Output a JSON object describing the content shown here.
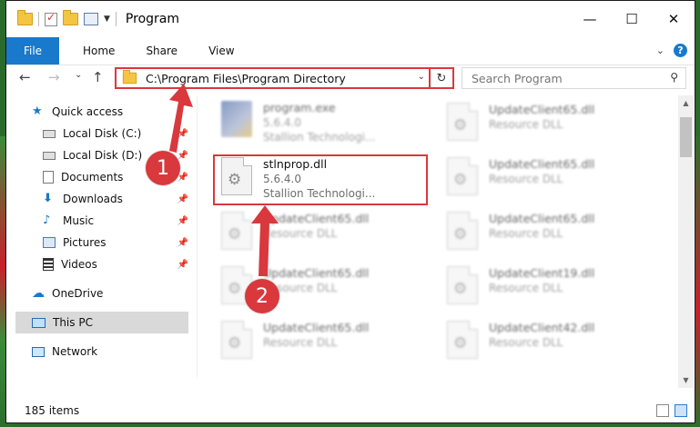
{
  "window": {
    "title": "Program",
    "minimize": "—",
    "maximize": "☐",
    "close": "✕"
  },
  "ribbon": {
    "tabs": [
      "File",
      "Home",
      "Share",
      "View"
    ],
    "help": "?"
  },
  "nav": {
    "back": "←",
    "forward": "→",
    "recent": "⌄",
    "up": "↑",
    "address": "C:\\Program Files\\Program Directory",
    "refresh": "↻",
    "search_placeholder": "Search Program"
  },
  "sidebar": {
    "items": [
      {
        "label": "Quick access",
        "pinned": false
      },
      {
        "label": "Local Disk (C:)",
        "pinned": true
      },
      {
        "label": "Local Disk (D:)",
        "pinned": true
      },
      {
        "label": "Documents",
        "pinned": true
      },
      {
        "label": "Downloads",
        "pinned": true
      },
      {
        "label": "Music",
        "pinned": true
      },
      {
        "label": "Pictures",
        "pinned": true
      },
      {
        "label": "Videos",
        "pinned": true
      },
      {
        "label": "OneDrive",
        "pinned": false
      },
      {
        "label": "This PC",
        "pinned": false
      },
      {
        "label": "Network",
        "pinned": false
      }
    ],
    "pin_glyph": "📌"
  },
  "files": {
    "left": [
      {
        "name": "program.exe",
        "line2": "5.6.4.0",
        "line3": "Stallion Technologi..."
      },
      {
        "name": "stlnprop.dll",
        "line2": "5.6.4.0",
        "line3": "Stallion Technologi..."
      },
      {
        "name": "UpdateClient65.dll",
        "line2": "Resource DLL"
      },
      {
        "name": "UpdateClient65.dll",
        "line2": "Resource DLL"
      },
      {
        "name": "UpdateClient65.dll",
        "line2": "Resource DLL"
      }
    ],
    "right": [
      {
        "name": "UpdateClient65.dll",
        "line2": "Resource DLL"
      },
      {
        "name": "UpdateClient65.dll",
        "line2": "Resource DLL"
      },
      {
        "name": "UpdateClient65.dll",
        "line2": "Resource DLL"
      },
      {
        "name": "UpdateClient19.dll",
        "line2": "Resource DLL"
      },
      {
        "name": "UpdateClient42.dll",
        "line2": "Resource DLL"
      }
    ]
  },
  "status": {
    "items_count": "185 items"
  },
  "callouts": [
    "1",
    "2"
  ],
  "colors": {
    "accent": "#1979ca",
    "highlight": "#d9383d",
    "selected_bg": "#d9d9d9"
  }
}
